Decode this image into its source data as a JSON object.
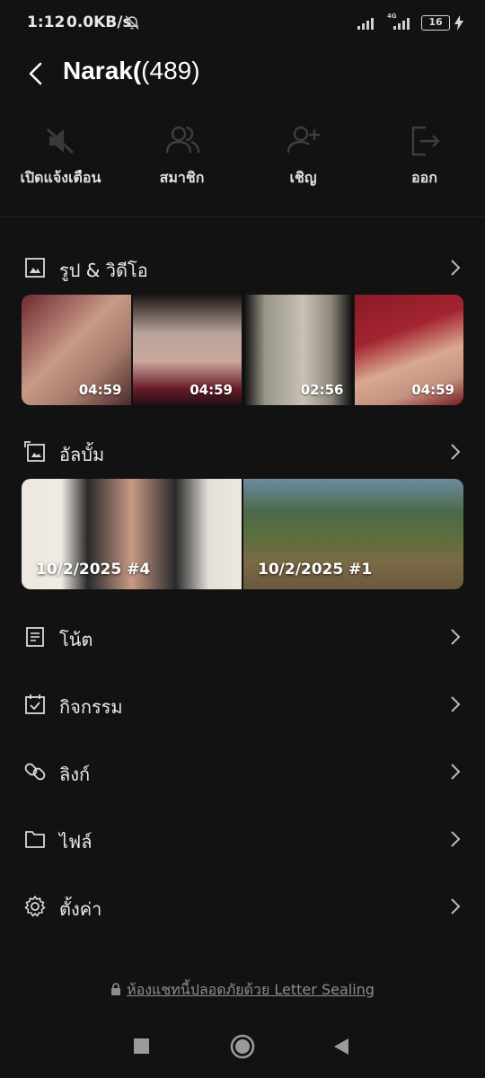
{
  "status_bar": {
    "time": "1:12",
    "speed": "0.0KB/s",
    "network_label": "4G",
    "battery": "16"
  },
  "header": {
    "title_name": "Narak(",
    "title_count": "(489)"
  },
  "actions": [
    {
      "label": "เปิดแจ้งเตือน",
      "icon": "mute-icon"
    },
    {
      "label": "สมาชิก",
      "icon": "members-icon"
    },
    {
      "label": "เชิญ",
      "icon": "invite-icon"
    },
    {
      "label": "ออก",
      "icon": "leave-icon"
    }
  ],
  "sections": {
    "media": {
      "label": "รูป & วิดีโอ"
    },
    "albums": {
      "label": "อัลบั้ม"
    },
    "notes": {
      "label": "โน้ต"
    },
    "events": {
      "label": "กิจกรรม"
    },
    "links": {
      "label": "ลิงก์"
    },
    "files": {
      "label": "ไฟล์"
    },
    "settings": {
      "label": "ตั้งค่า"
    }
  },
  "media_thumbs": [
    {
      "duration": "04:59"
    },
    {
      "duration": "04:59"
    },
    {
      "duration": "02:56"
    },
    {
      "duration": "04:59"
    }
  ],
  "albums": [
    {
      "name": "10/2/2025 #4"
    },
    {
      "name": "10/2/2025 #1"
    }
  ],
  "footer": {
    "note": "ห้องแชทนี้ปลอดภัยด้วย Letter Sealing"
  },
  "colors": {
    "background": "#121212",
    "text": "#e8e8e8",
    "muted": "#8e8e8e",
    "icon_dim": "#4a4a4a"
  }
}
